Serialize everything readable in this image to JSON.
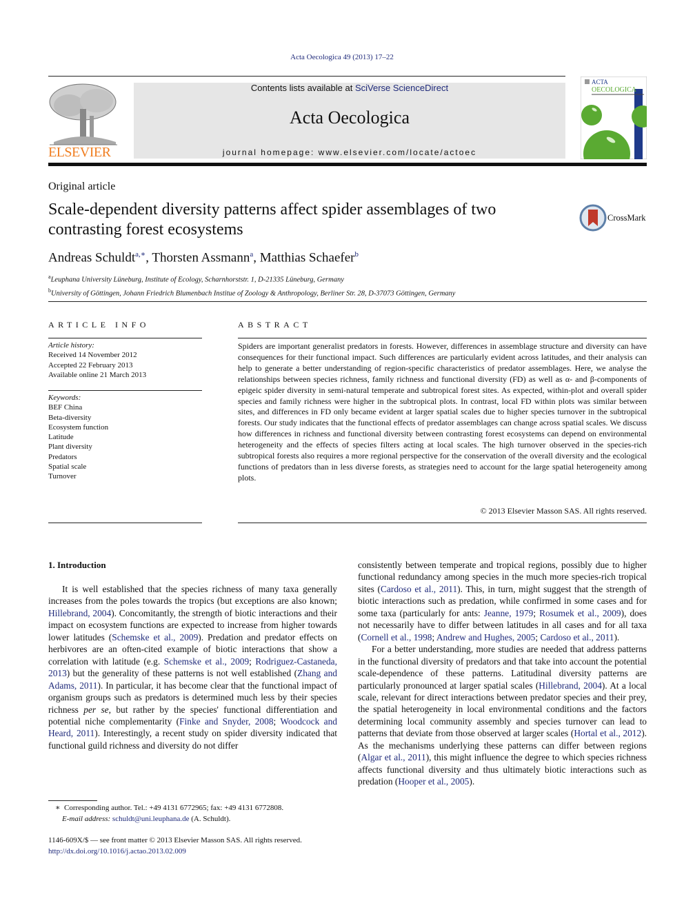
{
  "header": {
    "citation": "Acta Oecologica 49 (2013) 17–22",
    "contents_prefix": "Contents lists available at ",
    "contents_link": "SciVerse ScienceDirect",
    "journal_name": "Acta Oecologica",
    "homepage": "journal homepage: www.elsevier.com/locate/actoec",
    "publisher_logo_text": "ELSEVIER",
    "cover": {
      "line1": "ACTA",
      "line2": "OECOLOGICA"
    },
    "crossmark_label": "CrossMark",
    "colors": {
      "elsevier_orange": "#f07e21",
      "link_blue": "#1f2a7a",
      "cover_green": "#5aaa32",
      "cover_blue": "#1f3a8a"
    }
  },
  "article": {
    "type": "Original article",
    "title": "Scale-dependent diversity patterns affect spider assemblages of two contrasting forest ecosystems",
    "authors": [
      {
        "name": "Andreas Schuldt",
        "sup": "a,∗",
        "sep": ", "
      },
      {
        "name": "Thorsten Assmann",
        "sup": "a",
        "sep": ", "
      },
      {
        "name": "Matthias Schaefer",
        "sup": "b",
        "sep": ""
      }
    ],
    "affiliations": [
      {
        "mark": "a",
        "text": "Leuphana University Lüneburg, Institute of Ecology, Scharnhorststr. 1, D-21335 Lüneburg, Germany"
      },
      {
        "mark": "b",
        "text": "University of Göttingen, Johann Friedrich Blumenbach Institue of Zoology & Anthropology, Berliner Str. 28, D-37073 Göttingen, Germany"
      }
    ]
  },
  "article_info": {
    "heading": "ARTICLE INFO",
    "history_label": "Article history:",
    "history": [
      "Received 14 November 2012",
      "Accepted 22 February 2013",
      "Available online 21 March 2013"
    ],
    "keywords_label": "Keywords:",
    "keywords": [
      "BEF China",
      "Beta-diversity",
      "Ecosystem function",
      "Latitude",
      "Plant diversity",
      "Predators",
      "Spatial scale",
      "Turnover"
    ]
  },
  "abstract": {
    "heading": "ABSTRACT",
    "text": "Spiders are important generalist predators in forests. However, differences in assemblage structure and diversity can have consequences for their functional impact. Such differences are particularly evident across latitudes, and their analysis can help to generate a better understanding of region-specific characteristics of predator assemblages. Here, we analyse the relationships between species richness, family richness and functional diversity (FD) as well as α- and β-components of epigeic spider diversity in semi-natural temperate and subtropical forest sites. As expected, within-plot and overall spider species and family richness were higher in the subtropical plots. In contrast, local FD within plots was similar between sites, and differences in FD only became evident at larger spatial scales due to higher species turnover in the subtropical forests. Our study indicates that the functional effects of predator assemblages can change across spatial scales. We discuss how differences in richness and functional diversity between contrasting forest ecosystems can depend on environmental heterogeneity and the effects of species filters acting at local scales. The high turnover observed in the species-rich subtropical forests also requires a more regional perspective for the conservation of the overall diversity and the ecological functions of predators than in less diverse forests, as strategies need to account for the large spatial heterogeneity among plots.",
    "copyright": "© 2013 Elsevier Masson SAS. All rights reserved."
  },
  "intro": {
    "heading": "1.  Introduction",
    "left_paragraph": [
      {
        "t": "It is well established that the species richness of many taxa generally increases from the poles towards the tropics (but exceptions are also known; "
      },
      {
        "link": "Hillebrand, 2004"
      },
      {
        "t": "). Concomitantly, the strength of biotic interactions and their impact on ecosystem functions are expected to increase from higher towards lower latitudes ("
      },
      {
        "link": "Schemske et al., 2009"
      },
      {
        "t": "). Predation and predator effects on herbivores are an often-cited example of biotic interactions that show a correlation with latitude (e.g. "
      },
      {
        "link": "Schemske et al., 2009"
      },
      {
        "t": "; "
      },
      {
        "link": "Rodriguez-Castaneda, 2013"
      },
      {
        "t": ") but the generality of these patterns is not well established ("
      },
      {
        "link": "Zhang and Adams, 2011"
      },
      {
        "t": "). In particular, it has become clear that the functional impact of organism groups such as predators is determined much less by their species richness "
      },
      {
        "i": "per se"
      },
      {
        "t": ", but rather by the species' functional differentiation and potential niche complementarity ("
      },
      {
        "link": "Finke and Snyder, 2008"
      },
      {
        "t": "; "
      },
      {
        "link": "Woodcock and Heard, 2011"
      },
      {
        "t": "). Interestingly, a recent study on spider diversity indicated that functional guild richness and diversity do not differ"
      }
    ],
    "right_paragraph_1": [
      {
        "t": "consistently between temperate and tropical regions, possibly due to higher functional redundancy among species in the much more species-rich tropical sites ("
      },
      {
        "link": "Cardoso et al., 2011"
      },
      {
        "t": "). This, in turn, might suggest that the strength of biotic interactions such as predation, while confirmed in some cases and for some taxa (particularly for ants: "
      },
      {
        "link": "Jeanne, 1979"
      },
      {
        "t": "; "
      },
      {
        "link": "Rosumek et al., 2009"
      },
      {
        "t": "), does not necessarily have to differ between latitudes in all cases and for all taxa ("
      },
      {
        "link": "Cornell et al., 1998"
      },
      {
        "t": "; "
      },
      {
        "link": "Andrew and Hughes, 2005"
      },
      {
        "t": "; "
      },
      {
        "link": "Cardoso et al., 2011"
      },
      {
        "t": ")."
      }
    ],
    "right_paragraph_2": [
      {
        "t": "For a better understanding, more studies are needed that address patterns in the functional diversity of predators and that take into account the potential scale-dependence of these patterns. Latitudinal diversity patterns are particularly pronounced at larger spatial scales ("
      },
      {
        "link": "Hillebrand, 2004"
      },
      {
        "t": "). At a local scale, relevant for direct interactions between predator species and their prey, the spatial heterogeneity in local environmental conditions and the factors determining local community assembly and species turnover can lead to patterns that deviate from those observed at larger scales ("
      },
      {
        "link": "Hortal et al., 2012"
      },
      {
        "t": "). As the mechanisms underlying these patterns can differ between regions ("
      },
      {
        "link": "Algar et al., 2011"
      },
      {
        "t": "), this might influence the degree to which species richness affects functional diversity and thus ultimately biotic interactions such as predation ("
      },
      {
        "link": "Hooper et al., 2005"
      },
      {
        "t": ")."
      }
    ]
  },
  "footnote": {
    "mark": "∗",
    "corresponding": "Corresponding author. Tel.: +49 4131 6772965; fax: +49 4131 6772808.",
    "email_label": "E-mail address:",
    "email": "schuldt@uni.leuphana.de",
    "email_suffix": " (A. Schuldt)."
  },
  "front_matter": {
    "issn_line": "1146-609X/$ — see front matter © 2013 Elsevier Masson SAS. All rights reserved.",
    "doi": "http://dx.doi.org/10.1016/j.actao.2013.02.009"
  }
}
